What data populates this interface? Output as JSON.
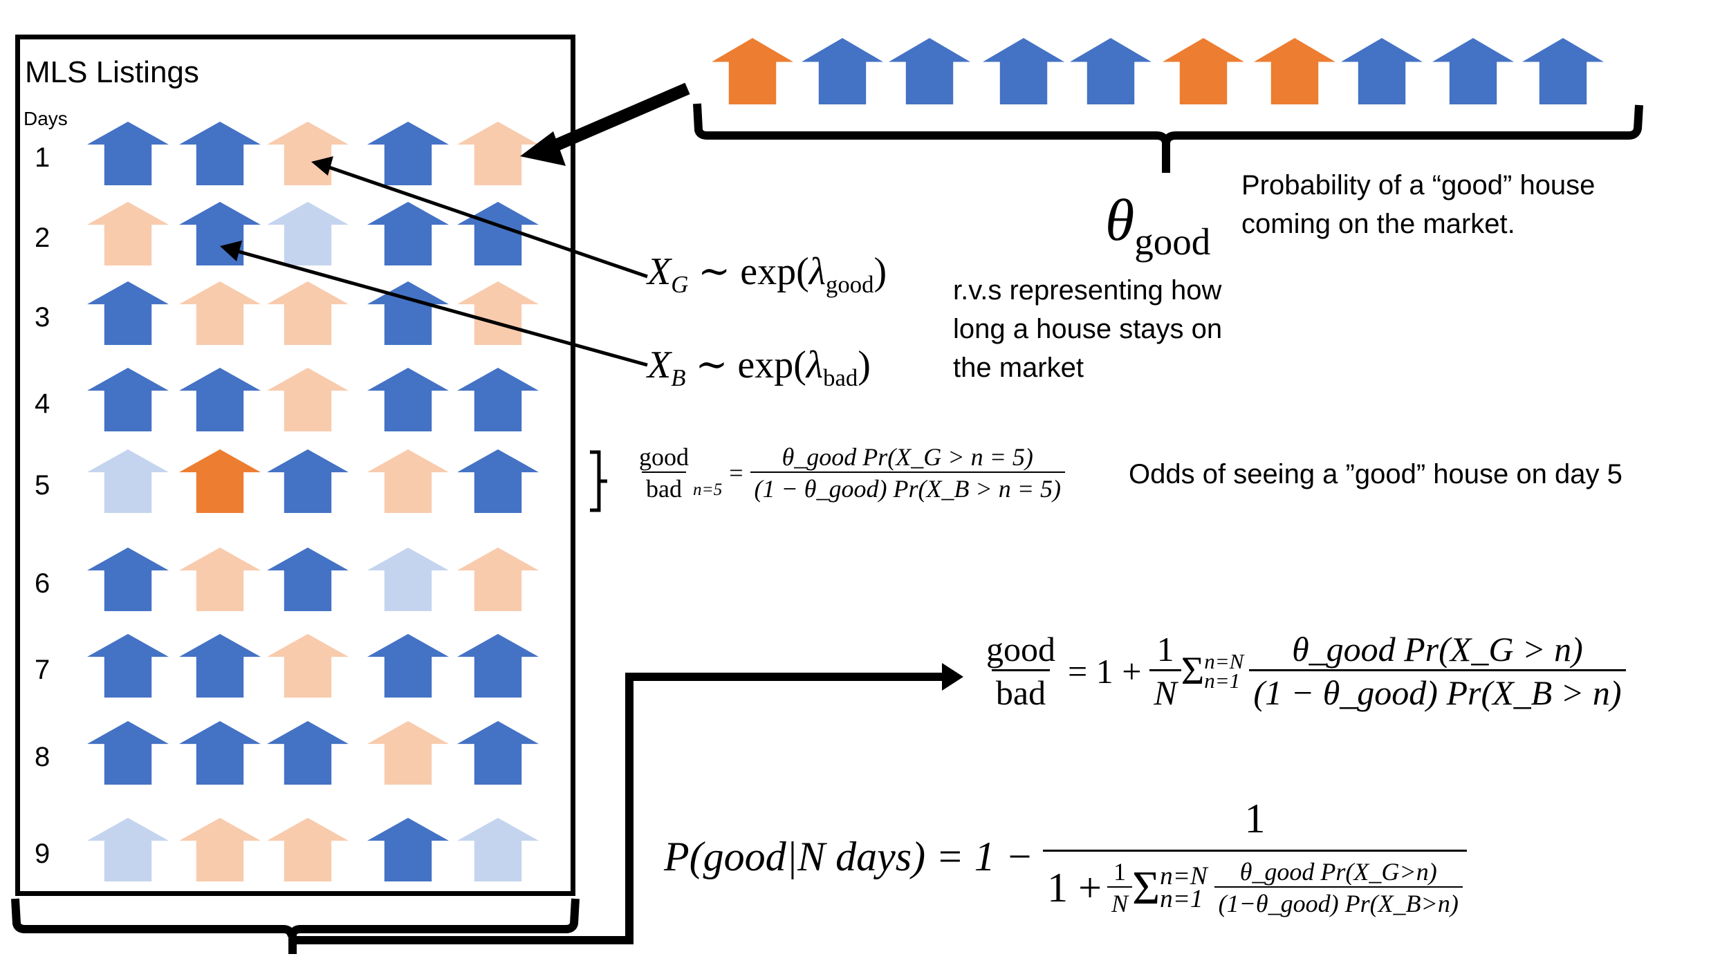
{
  "colors": {
    "good": "#ED7D31",
    "bad": "#4472C4",
    "good_faded": "#F8CBAD",
    "bad_faded": "#C5D4EE",
    "ink": "#000000"
  },
  "listings": {
    "title": "MLS Listings",
    "days_label": "Days",
    "rows": [
      {
        "day": "1",
        "houses": [
          "bad",
          "bad",
          "good_faded",
          "bad",
          "good_faded"
        ]
      },
      {
        "day": "2",
        "houses": [
          "good_faded",
          "bad",
          "bad_faded",
          "bad",
          "bad"
        ]
      },
      {
        "day": "3",
        "houses": [
          "bad",
          "good_faded",
          "good_faded",
          "bad",
          "good_faded"
        ]
      },
      {
        "day": "4",
        "houses": [
          "bad",
          "bad",
          "good_faded",
          "bad",
          "bad"
        ]
      },
      {
        "day": "5",
        "houses": [
          "bad_faded",
          "good",
          "bad",
          "good_faded",
          "bad"
        ]
      },
      {
        "day": "6",
        "houses": [
          "bad",
          "good_faded",
          "bad",
          "bad_faded",
          "good_faded"
        ]
      },
      {
        "day": "7",
        "houses": [
          "bad",
          "bad",
          "good_faded",
          "bad",
          "bad"
        ]
      },
      {
        "day": "8",
        "houses": [
          "bad",
          "bad",
          "bad",
          "good_faded",
          "bad"
        ]
      },
      {
        "day": "9",
        "houses": [
          "bad_faded",
          "good_faded",
          "good_faded",
          "bad",
          "bad_faded"
        ]
      }
    ]
  },
  "new_listings": {
    "houses": [
      "good",
      "bad",
      "bad",
      "bad",
      "bad",
      "good",
      "good",
      "bad",
      "bad",
      "bad"
    ]
  },
  "theta": {
    "symbol": "θ",
    "subscript": "good",
    "description_line1": "Probability of a “good” house",
    "description_line2": "coming on the market."
  },
  "rvs": {
    "xg": {
      "var": "X",
      "var_sub": "G",
      "op": "∼",
      "fn": "exp",
      "param": "λ",
      "param_sub": "good"
    },
    "xb": {
      "var": "X",
      "var_sub": "B",
      "op": "∼",
      "fn": "exp",
      "param": "λ",
      "param_sub": "bad"
    },
    "description_line1": "r.v.s representing how",
    "description_line2": "long a house stays on",
    "description_line3": "the market"
  },
  "odds_day5": {
    "lhs_num": "good",
    "lhs_den": "bad",
    "lhs_sub": "n=5",
    "eq": "=",
    "rhs_num": "θ_good Pr(X_G > n = 5)",
    "rhs_den": "(1 − θ_good) Pr(X_B > n = 5)",
    "description": "Odds of seeing a ”good” house on day 5"
  },
  "odds_avg": {
    "lhs_num": "good",
    "lhs_den": "bad",
    "eq": "= 1 +",
    "one": "1",
    "N": "N",
    "sum": "Σ",
    "sum_upper": "n=N",
    "sum_lower": "n=1",
    "rhs_num": "θ_good Pr(X_G > n)",
    "rhs_den": "(1 − θ_good) Pr(X_B > n)"
  },
  "posterior": {
    "lhs": "P(good|N days) = 1 −",
    "num": "1",
    "den_prefix": "1 +",
    "one": "1",
    "N": "N",
    "sum": "Σ",
    "sum_upper": "n=N",
    "sum_lower": "n=1",
    "inner_num": "θ_good Pr(X_G>n)",
    "inner_den": "(1−θ_good) Pr(X_B>n)"
  }
}
